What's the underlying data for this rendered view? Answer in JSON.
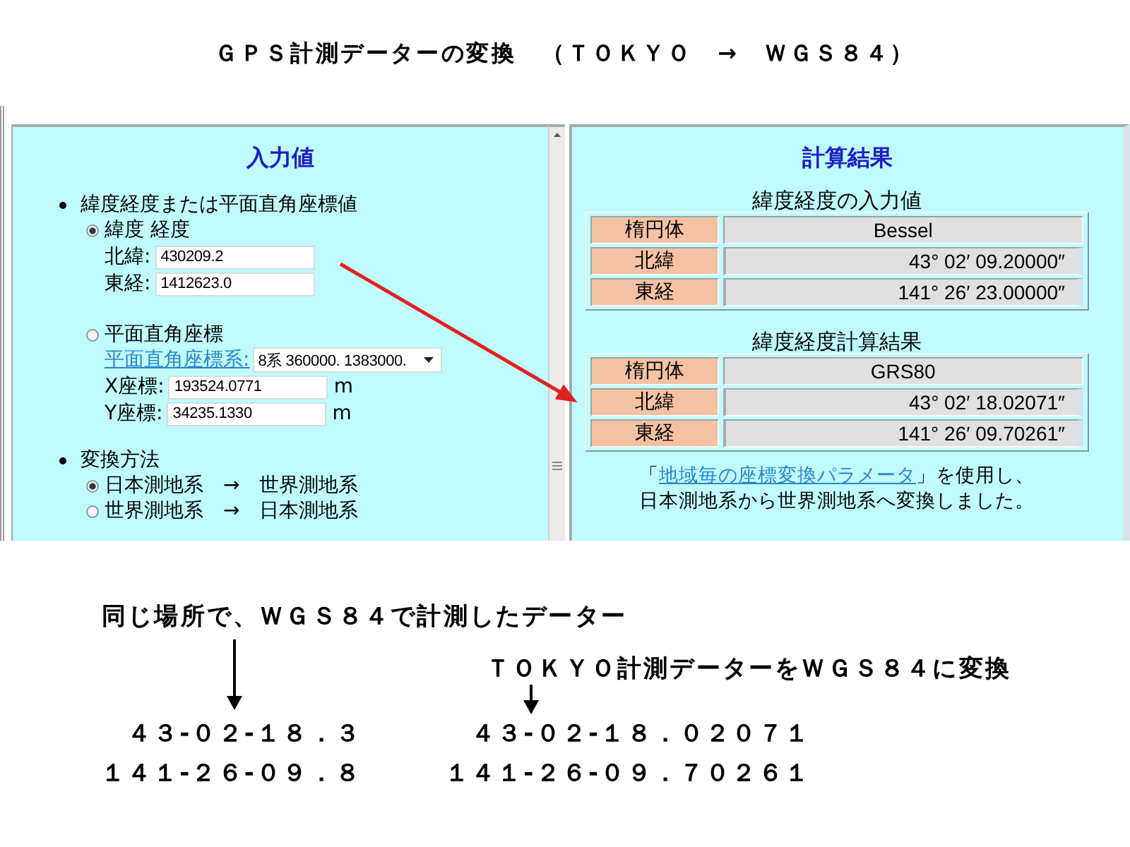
{
  "title": "ＧＰＳ計測データーの変換　（ＴＯＫＹＯ　→　ＷＧＳ８４）",
  "input_panel": {
    "heading": "入力値",
    "sections": [
      {
        "label": "緯度経度または平面直角座標値",
        "options": [
          {
            "kind": "latlon",
            "label": "緯度 経度",
            "selected": true,
            "fields": [
              {
                "label": "北緯:",
                "value": "430209.2"
              },
              {
                "label": "東経:",
                "value": "1412623.0"
              }
            ]
          },
          {
            "kind": "plane",
            "label": "平面直角座標",
            "selected": false,
            "system_link": "平面直角座標系:",
            "system_select": "8系 360000. 1383000.",
            "fields": [
              {
                "label": "X座標:",
                "value": "193524.0771",
                "unit": "m"
              },
              {
                "label": "Y座標:",
                "value": "34235.1330",
                "unit": "m"
              }
            ]
          }
        ]
      },
      {
        "label": "変換方法",
        "options": [
          {
            "kind": "plain",
            "label": "日本測地系　→　世界測地系",
            "selected": true
          },
          {
            "kind": "plain",
            "label": "世界測地系　→　日本測地系",
            "selected": false
          }
        ]
      }
    ]
  },
  "result_panel": {
    "heading": "計算結果",
    "tables": [
      {
        "caption": "緯度経度の入力値",
        "rows": [
          {
            "kind": "name",
            "label": "楕円体",
            "value": "Bessel"
          },
          {
            "kind": "angle",
            "label": "北緯",
            "value": "43° 02′ 09.20000″"
          },
          {
            "kind": "angle",
            "label": "東経",
            "value": "141° 26′ 23.00000″"
          }
        ]
      },
      {
        "caption": "緯度経度計算結果",
        "rows": [
          {
            "kind": "name",
            "label": "楕円体",
            "value": "GRS80"
          },
          {
            "kind": "angle",
            "label": "北緯",
            "value": "43° 02′ 18.02071″"
          },
          {
            "kind": "angle",
            "label": "東経",
            "value": "141° 26′ 09.70261″"
          }
        ]
      }
    ],
    "note": {
      "before_link": "「",
      "link": "地域毎の座標変換パラメータ",
      "after_link": "」を使用し、",
      "second_line": "日本測地系から世界測地系へ変換しました。"
    }
  },
  "comparison": {
    "measured_label": "同じ場所で、ＷＧＳ８４で計測したデーター",
    "converted_label": "ＴＯＫＹＯ計測データーをＷＧＳ８４に変換",
    "measured_values": [
      "４３-０２-１８．３",
      "１４１-２６-０９．８"
    ],
    "converted_values": [
      "４３-０２-１８．０２０７１",
      "１４１-２６-０９．７０２６１"
    ]
  }
}
